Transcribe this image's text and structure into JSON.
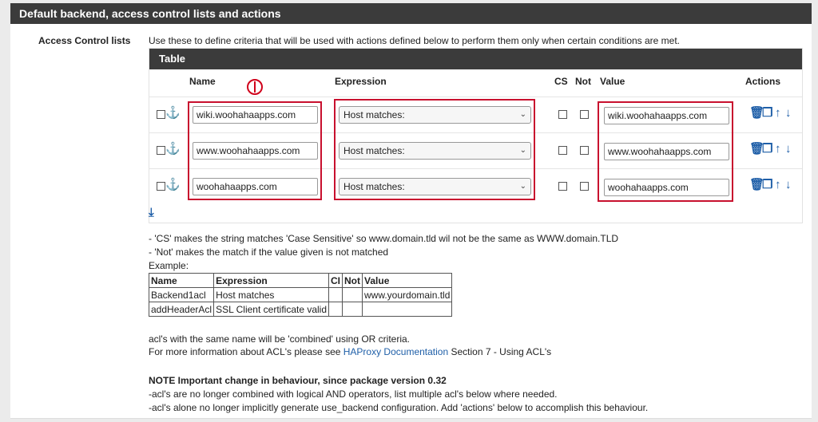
{
  "section": {
    "title": "Default backend, access control lists and actions"
  },
  "row_label": "Access Control lists",
  "intro": "Use these to define criteria that will be used with actions defined below to perform them only when certain conditions are met.",
  "table": {
    "title": "Table",
    "columns": {
      "name": "Name",
      "expression": "Expression",
      "cs": "CS",
      "not": "Not",
      "value": "Value",
      "actions": "Actions"
    },
    "rows": [
      {
        "name": "wiki.woohahaapps.com",
        "expression": "Host matches:",
        "value": "wiki.woohahaapps.com"
      },
      {
        "name": "www.woohahaapps.com",
        "expression": "Host matches:",
        "value": "www.woohahaapps.com"
      },
      {
        "name": "woohahaapps.com",
        "expression": "Host matches:",
        "value": "woohahaapps.com"
      }
    ]
  },
  "annotation": {
    "marker": "1"
  },
  "help": {
    "line1": "- 'CS' makes the string matches 'Case Sensitive' so www.domain.tld wil not be the same as WWW.domain.TLD",
    "line2": "- 'Not' makes the match if the value given is not matched",
    "example_label": "Example:",
    "example_headers": [
      "Name",
      "Expression",
      "CI",
      "Not",
      "Value"
    ],
    "example_rows": [
      [
        "Backend1acl",
        "Host matches",
        "",
        "",
        "www.yourdomain.tld"
      ],
      [
        "addHeaderAcl",
        "SSL Client certificate valid",
        "",
        "",
        ""
      ]
    ],
    "combined": "acl's with the same name will be 'combined' using OR criteria.",
    "more_info_prefix": "For more information about ACL's please see ",
    "more_info_link": "HAProxy Documentation",
    "more_info_suffix": " Section 7 - Using ACL's",
    "note_title": "NOTE Important change in behaviour, since package version 0.32",
    "note_line1": "-acl's are no longer combined with logical AND operators, list multiple acl's below where needed.",
    "note_line2": "-acl's alone no longer implicitly generate use_backend configuration. Add 'actions' below to accomplish this behaviour."
  },
  "colors": {
    "header_bg": "#3b3b3b",
    "link": "#1f5fa8",
    "annotation_red": "#c8102e"
  },
  "icons": {
    "row_select": "checkbox-icon",
    "drag": "anchor-icon",
    "delete": "trash-icon",
    "copy": "copy-icon",
    "move_up": "arrow-up-icon",
    "move_down": "arrow-down-icon",
    "add": "add-row-arrow-icon"
  }
}
